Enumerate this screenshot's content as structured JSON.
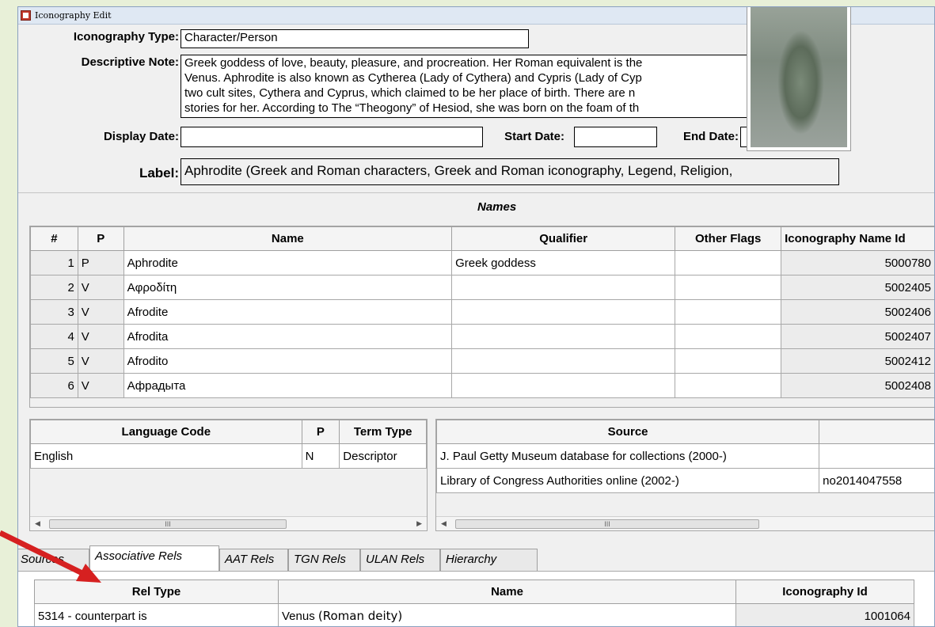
{
  "window": {
    "title": "Iconography Edit"
  },
  "form": {
    "type_label": "Iconography Type:",
    "type_value": "Character/Person",
    "note_label": "Descriptive Note:",
    "note_lines": [
      "Greek goddess of love, beauty, pleasure, and procreation. Her Roman equivalent is the",
      "Venus. Aphrodite is also known as Cytherea (Lady of Cythera) and Cypris (Lady of Cyp",
      "two cult sites, Cythera and Cyprus, which claimed to be her place of birth. There are n",
      "stories for her. According to The “Theogony” of Hesiod, she was born on the foam of th"
    ],
    "display_date_label": "Display Date:",
    "display_date_value": "",
    "start_date_label": "Start Date:",
    "start_date_value": "",
    "end_date_label": "End Date:",
    "end_date_value": "",
    "label_label": "Label:",
    "label_value": "Aphrodite (Greek and Roman characters, Greek and Roman iconography, Legend, Religion,"
  },
  "names": {
    "title": "Names",
    "columns": [
      "#",
      "P",
      "Name",
      "Qualifier",
      "Other Flags",
      "Iconography Name Id"
    ],
    "rows": [
      {
        "num": "1",
        "p": "P",
        "name": "Aphrodite",
        "qualifier": "Greek goddess",
        "flags": "",
        "id": "5000780"
      },
      {
        "num": "2",
        "p": "V",
        "name": "Αφροδίτη",
        "qualifier": "",
        "flags": "",
        "id": "5002405"
      },
      {
        "num": "3",
        "p": "V",
        "name": "Afrodite",
        "qualifier": "",
        "flags": "",
        "id": "5002406"
      },
      {
        "num": "4",
        "p": "V",
        "name": "Afrodita",
        "qualifier": "",
        "flags": "",
        "id": "5002407"
      },
      {
        "num": "5",
        "p": "V",
        "name": "Afrodito",
        "qualifier": "",
        "flags": "",
        "id": "5002412"
      },
      {
        "num": "6",
        "p": "V",
        "name": "Афрадыта",
        "qualifier": "",
        "flags": "",
        "id": "5002408"
      }
    ]
  },
  "language": {
    "columns": [
      "Language Code",
      "P",
      "Term Type"
    ],
    "rows": [
      {
        "code": "English",
        "p": "N",
        "type": "Descriptor"
      }
    ]
  },
  "source": {
    "columns": [
      "Source",
      ""
    ],
    "rows": [
      {
        "source": "J. Paul Getty Museum database for collections (2000-)",
        "extra": ""
      },
      {
        "source": "Library of Congress Authorities online (2002-)",
        "extra": "no2014047558"
      }
    ]
  },
  "scroll_glyph": "III",
  "tabs": [
    "Sources",
    "Associative Rels",
    "AAT Rels",
    "TGN Rels",
    "ULAN Rels",
    "Hierarchy"
  ],
  "active_tab": "Associative Rels",
  "rels": {
    "columns": [
      "Rel Type",
      "Name",
      "Iconography Id"
    ],
    "rows": [
      {
        "rel_type": "5314 - counterpart is",
        "name": "Venus",
        "qualifier": "(Roman deity)",
        "id": "1001064"
      }
    ]
  },
  "colors": {
    "arrow": "#d62020",
    "window_bg": "#f0f0f0",
    "page_bg": "#e8f0d8"
  }
}
